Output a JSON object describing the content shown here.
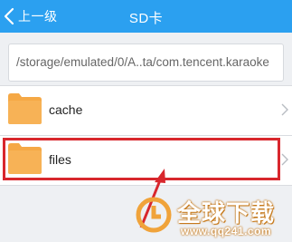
{
  "header": {
    "back_label": "上一级",
    "title": "SD卡"
  },
  "path": {
    "value": "/storage/emulated/0/A..ta/com.tencent.karaoke"
  },
  "items": [
    {
      "name": "cache",
      "icon": "folder-icon"
    },
    {
      "name": "files",
      "icon": "folder-icon"
    }
  ],
  "annotation": {
    "highlight_color": "#d8272d"
  },
  "watermark": {
    "text": "全球下载",
    "url": "www.qq241.com"
  },
  "colors": {
    "titlebar": "#2ba0f0",
    "folder": "#f5a845",
    "background": "#eef0f3"
  }
}
